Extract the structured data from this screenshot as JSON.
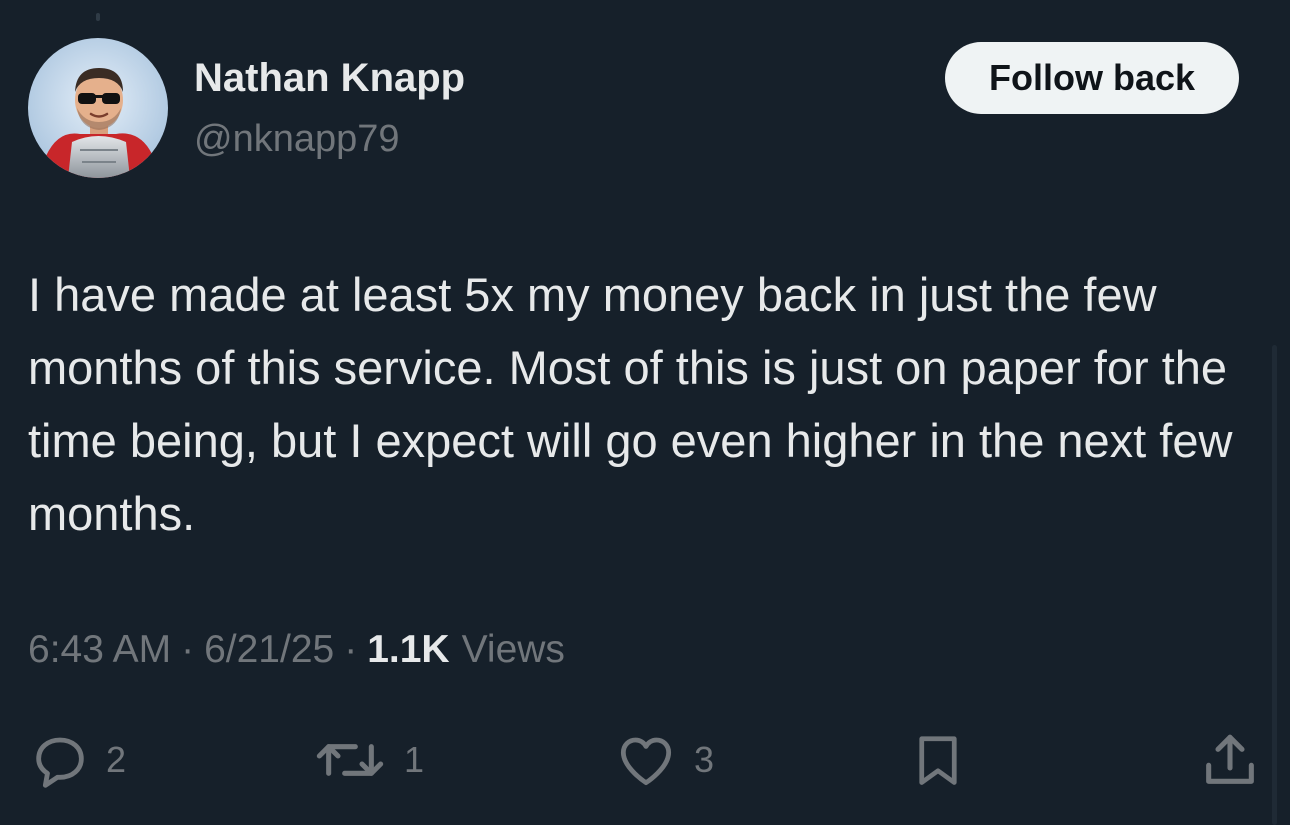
{
  "user": {
    "name": "Nathan Knapp",
    "handle": "@nknapp79"
  },
  "follow_button": {
    "label": "Follow back"
  },
  "tweet": {
    "text": "I have made at least 5x my money back in just the few months of this service.  Most of this is just on paper for the time being, but I expect will go even higher in the next few months.",
    "time": "6:43 AM",
    "date": "6/21/25",
    "separator": "·",
    "views_count": "1.1K",
    "views_label": "Views"
  },
  "actions": {
    "replies": "2",
    "reposts": "1",
    "likes": "3"
  },
  "icons": {
    "reply": "reply-icon",
    "repost": "repost-icon",
    "like": "heart-icon",
    "bookmark": "bookmark-icon",
    "share": "share-icon"
  },
  "colors": {
    "background": "#16202a",
    "primary_text": "#e7e9ea",
    "secondary_text": "#71767b",
    "button_bg": "#eff3f4"
  }
}
